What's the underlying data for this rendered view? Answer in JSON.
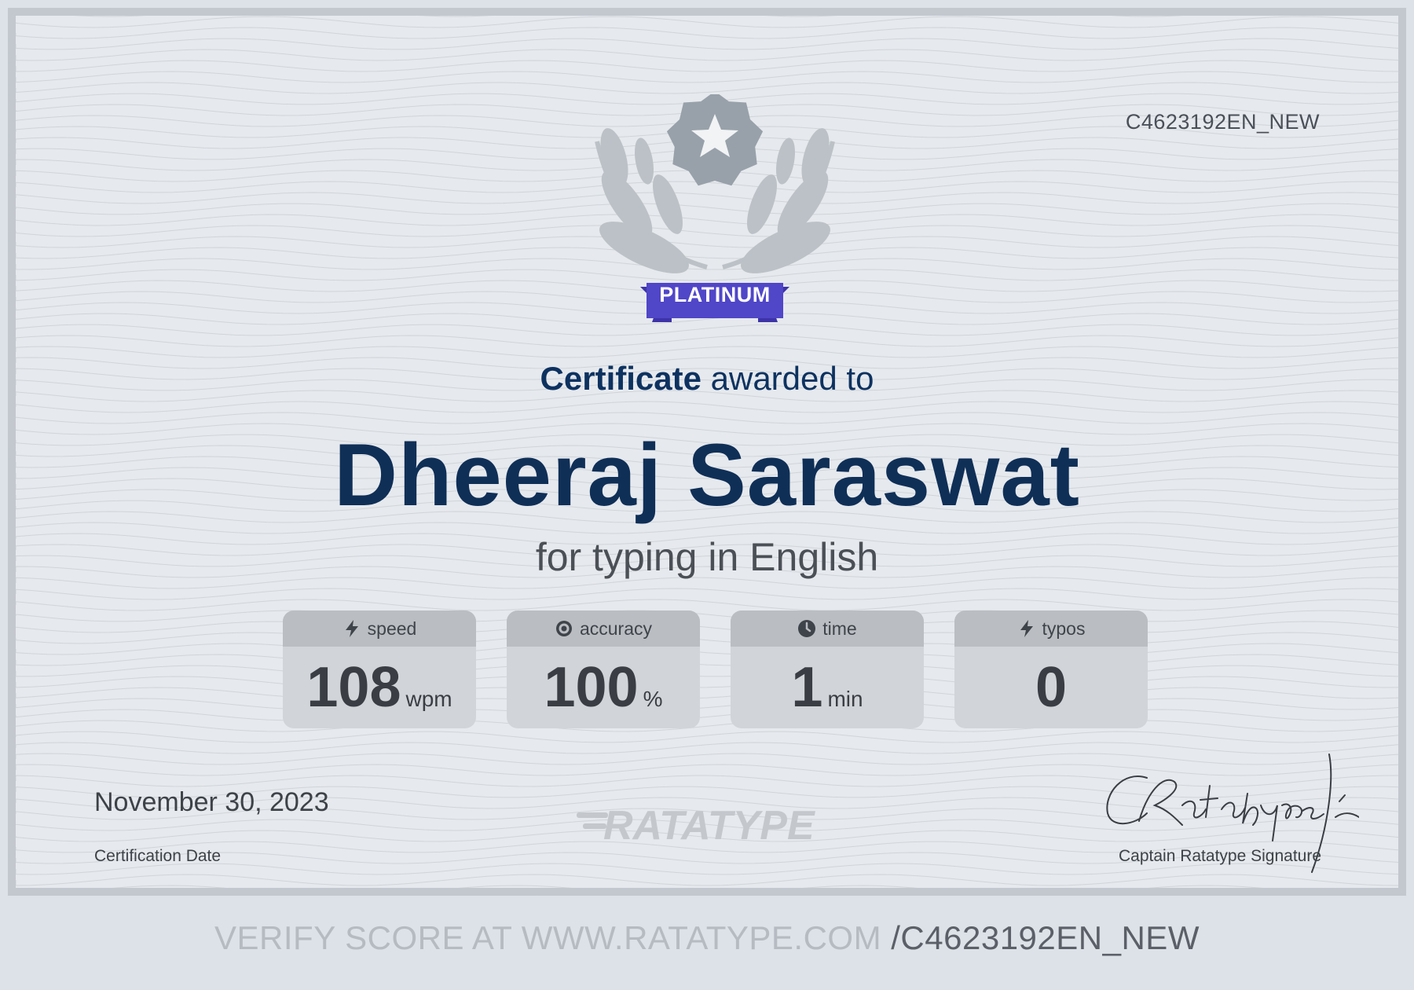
{
  "certificate": {
    "code": "C4623192EN_NEW",
    "badge_label": "PLATINUM",
    "awarded_strong": "Certificate",
    "awarded_rest": "awarded to",
    "recipient_name": "Dheeraj Saraswat",
    "subtitle": "for typing in English",
    "date": "November 30, 2023",
    "date_label": "Certification Date",
    "signature_label": "Captain Ratatype Signature",
    "logo_text": "RATATYPE"
  },
  "stats": [
    {
      "label": "speed",
      "value": "108",
      "unit": "wpm",
      "icon": "lightning-icon"
    },
    {
      "label": "accuracy",
      "value": "100",
      "unit": "%",
      "icon": "target-icon"
    },
    {
      "label": "time",
      "value": "1",
      "unit": "min",
      "icon": "clock-icon"
    },
    {
      "label": "typos",
      "value": "0",
      "unit": "",
      "icon": "lightning-icon"
    }
  ],
  "footer": {
    "verify_prefix": "VERIFY SCORE AT WWW.RATATYPE.COM",
    "verify_code": "/C4623192EN_NEW"
  },
  "colors": {
    "name": "#0f2f57",
    "ribbon": "#5046c8",
    "medal": "#98a1a9",
    "border": "#c3c8cf"
  }
}
